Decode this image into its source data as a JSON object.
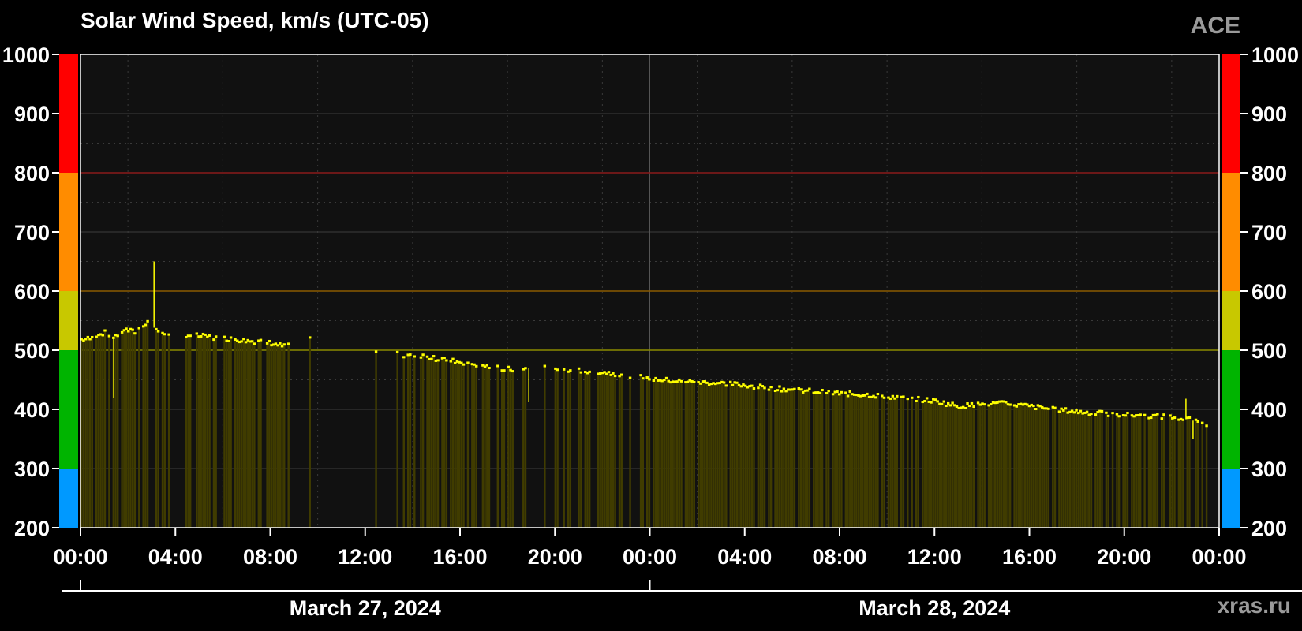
{
  "title": "Solar Wind Speed, km/s (UTC-05)",
  "source": "ACE",
  "credit": "xras.ru",
  "chart_data": {
    "type": "bar",
    "title": "Solar Wind Speed, km/s (UTC-05)",
    "ylim": [
      200,
      1000
    ],
    "y_ticks": [
      200,
      300,
      400,
      500,
      600,
      700,
      800,
      900,
      1000
    ],
    "x_tick_labels": [
      "00:00",
      "04:00",
      "08:00",
      "12:00",
      "16:00",
      "20:00",
      "00:00",
      "04:00",
      "08:00",
      "12:00",
      "16:00",
      "20:00",
      "00:00"
    ],
    "x_range_hours": [
      0,
      48
    ],
    "date_labels": [
      {
        "label": "March 27, 2024",
        "center_hour": 12
      },
      {
        "label": "March 28, 2024",
        "center_hour": 36
      }
    ],
    "grid": true,
    "threshold_lines": [
      {
        "value": 500,
        "color": "#8a8a00"
      },
      {
        "value": 600,
        "color": "#8a5a00"
      },
      {
        "value": 800,
        "color": "#8a1a1a"
      }
    ],
    "color_scale": [
      {
        "from": 200,
        "to": 300,
        "color": "#0099ff"
      },
      {
        "from": 300,
        "to": 500,
        "color": "#00b400"
      },
      {
        "from": 500,
        "to": 600,
        "color": "#c8c800"
      },
      {
        "from": 600,
        "to": 800,
        "color": "#ff8c00"
      },
      {
        "from": 800,
        "to": 1000,
        "color": "#ff0000"
      }
    ],
    "series": [
      {
        "fill_color": "#403c00",
        "line_color": "#ffff00",
        "x_hours": [
          0.0,
          0.5,
          1.0,
          1.3,
          1.8,
          2.3,
          2.8,
          3.3,
          4.0,
          5.0,
          6.0,
          7.0,
          8.0,
          8.6,
          9.6,
          12.5,
          13.5,
          14.5,
          15.5,
          16.5,
          17.5,
          18.5,
          19.5,
          20.0,
          21.0,
          22.0,
          23.0,
          24.0,
          25.0,
          26.0,
          27.0,
          28.0,
          29.0,
          30.0,
          31.0,
          32.0,
          33.0,
          34.0,
          35.0,
          36.0,
          37.0,
          38.0,
          39.0,
          40.0,
          41.0,
          42.0,
          43.0,
          44.0,
          45.0,
          46.0,
          46.8,
          47.5
        ],
        "values": [
          518,
          520,
          530,
          520,
          535,
          530,
          550,
          530,
          527,
          524,
          520,
          516,
          512,
          506,
          518,
          497,
          492,
          488,
          483,
          477,
          470,
          466,
          475,
          468,
          466,
          463,
          458,
          452,
          448,
          446,
          444,
          441,
          436,
          433,
          430,
          427,
          425,
          422,
          418,
          414,
          405,
          409,
          410,
          405,
          400,
          396,
          393,
          391,
          389,
          387,
          382,
          375
        ]
      }
    ]
  }
}
